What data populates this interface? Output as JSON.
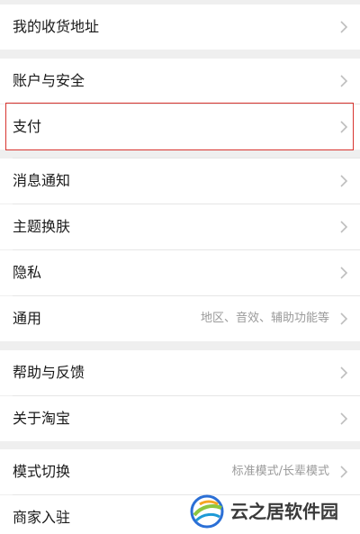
{
  "settings": {
    "items": [
      {
        "label": "我的收货地址"
      },
      {
        "label": "账户与安全"
      },
      {
        "label": "支付"
      },
      {
        "label": "消息通知"
      },
      {
        "label": "主题换肤"
      },
      {
        "label": "隐私"
      },
      {
        "label": "通用",
        "value": "地区、音效、辅助功能等"
      },
      {
        "label": "帮助与反馈"
      },
      {
        "label": "关于淘宝"
      },
      {
        "label": "模式切换",
        "value": "标准模式/长辈模式"
      },
      {
        "label": "商家入驻"
      }
    ]
  },
  "icons": {
    "chevron": "chevron-right-icon"
  },
  "colors": {
    "highlight_border": "#d8342f",
    "background": "#efefef",
    "row": "#ffffff",
    "secondary_text": "#9a9a9a"
  },
  "watermark": {
    "text": "云之居软件园"
  }
}
